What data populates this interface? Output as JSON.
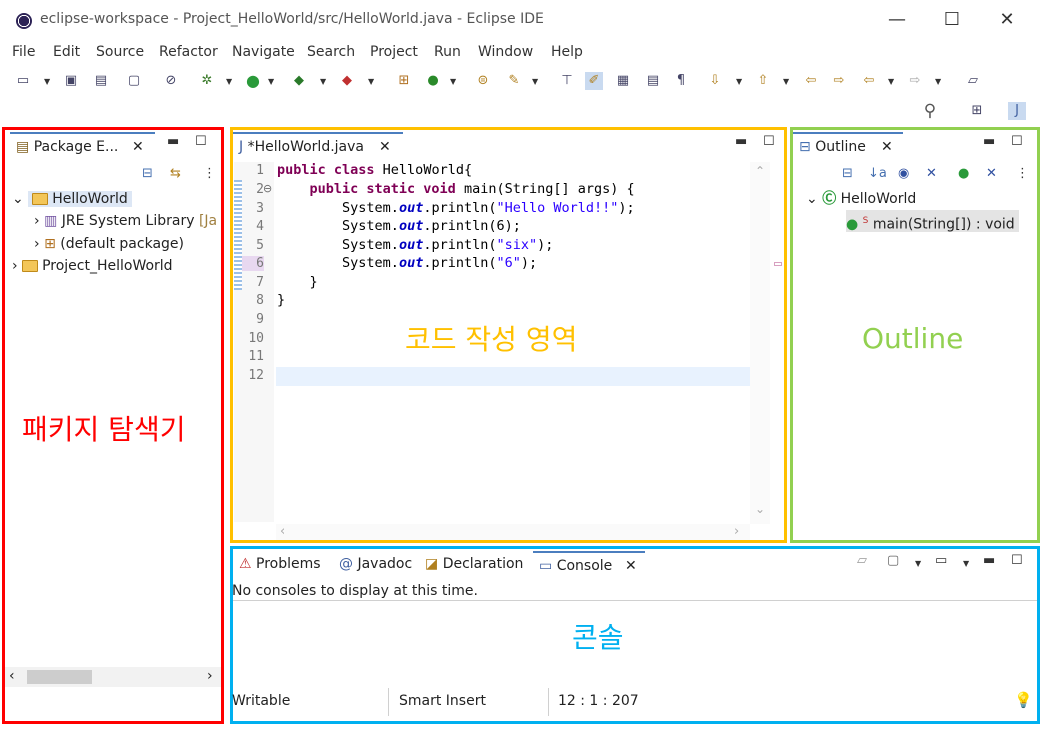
{
  "window": {
    "title": "eclipse-workspace - Project_HelloWorld/src/HelloWorld.java - Eclipse IDE",
    "minimize": "—",
    "maximize": "☐",
    "close": "✕"
  },
  "menu": [
    "File",
    "Edit",
    "Source",
    "Refactor",
    "Navigate",
    "Search",
    "Project",
    "Run",
    "Window",
    "Help"
  ],
  "package_explorer": {
    "tab_label": "Package E...",
    "tree": {
      "project_open": "HelloWorld",
      "jre_label": "JRE System Library",
      "jre_suffix": "[Ja",
      "default_package": "(default package)",
      "project_closed": "Project_HelloWorld"
    }
  },
  "editor": {
    "tab_label": "*HelloWorld.java",
    "line_numbers": [
      "1",
      "2",
      "3",
      "4",
      "5",
      "6",
      "7",
      "8",
      "9",
      "10",
      "11",
      "12"
    ],
    "code": {
      "l1_kw": "public class",
      "l1_rest": " HelloWorld{",
      "l2_kw": "public static void",
      "l2_rest": " main(String[] args) {",
      "sys": "System.",
      "out": "out",
      "println": ".println(",
      "close_call": ");",
      "l3_str": "\"Hello World!!\"",
      "l4_arg": "6",
      "l5_str": "\"six\"",
      "l6_str": "\"6\"",
      "l7": "}",
      "l8": "}"
    }
  },
  "outline": {
    "tab_label": "Outline",
    "class_name": "HelloWorld",
    "method_label": "main(String[]) : void",
    "method_modifier": "S"
  },
  "bottom_panel": {
    "tabs": [
      "Problems",
      "Javadoc",
      "Declaration",
      "Console"
    ],
    "console_message": "No consoles to display at this time."
  },
  "status_bar": {
    "writable": "Writable",
    "insert_mode": "Smart Insert",
    "position": "12 : 1 : 207"
  },
  "annotations": {
    "package_explorer": "패키지 탐색기",
    "code_area": "코드 작성 영역",
    "outline": "Outline",
    "console": "콘솔"
  },
  "colors": {
    "package_frame": "#ff0000",
    "editor_frame": "#ffc000",
    "outline_frame": "#92d050",
    "console_frame": "#00b0f0",
    "keyword": "#7f0055",
    "string": "#2a00ff"
  }
}
